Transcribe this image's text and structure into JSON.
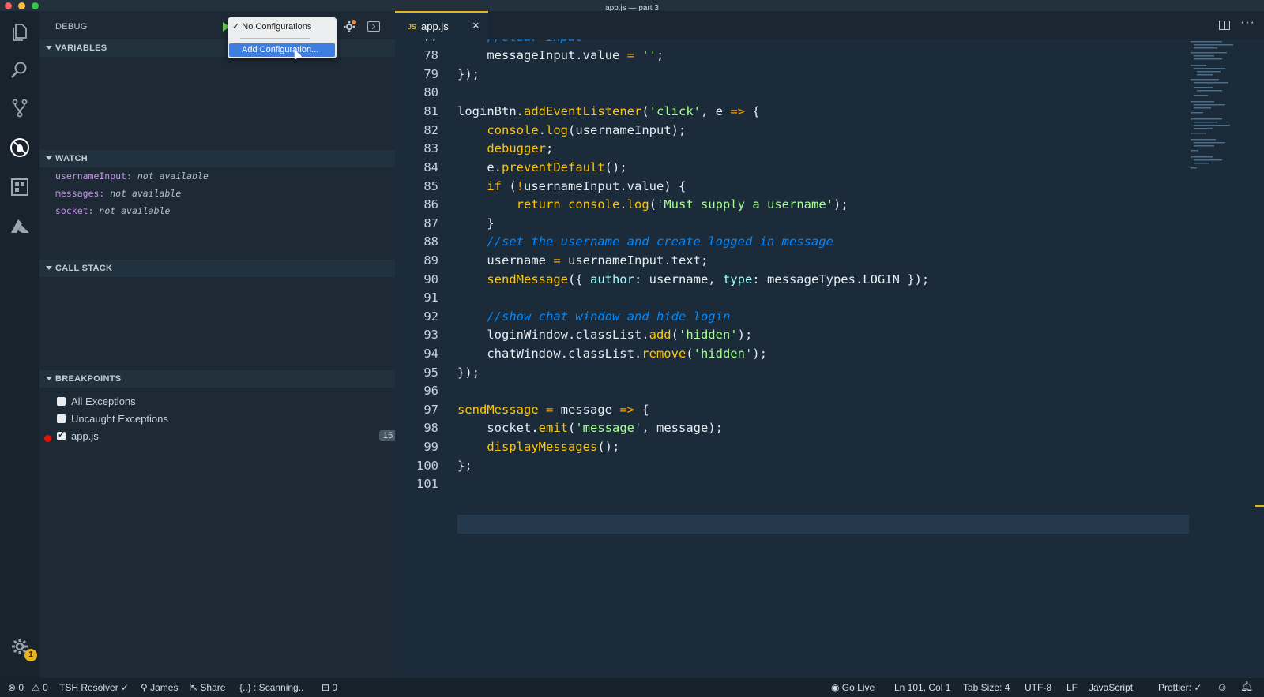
{
  "window": {
    "title": "app.js — part 3"
  },
  "colors": {
    "accent": "#e6b422",
    "breakpoint": "#e51400",
    "selection": "#3d7fe0"
  },
  "activity_bar": {
    "items": [
      "explorer-icon",
      "search-icon",
      "source-control-icon",
      "debug-icon",
      "extensions-icon",
      "azure-icon"
    ],
    "settings_badge": "1"
  },
  "debug": {
    "title": "DEBUG",
    "config_dropdown": {
      "selected": "✓ No Configurations",
      "option": "Add Configuration..."
    }
  },
  "sections": {
    "variables": "VARIABLES",
    "watch": "WATCH",
    "call_stack": "CALL STACK",
    "breakpoints": "BREAKPOINTS"
  },
  "watch": [
    {
      "name": "usernameInput:",
      "value": "not available"
    },
    {
      "name": "messages:",
      "value": "not available"
    },
    {
      "name": "socket:",
      "value": "not available"
    }
  ],
  "breakpoints": [
    {
      "label": "All Exceptions",
      "checked": false
    },
    {
      "label": "Uncaught Exceptions",
      "checked": false
    },
    {
      "label": "app.js",
      "checked": true,
      "count": "15"
    }
  ],
  "editor": {
    "tab": {
      "icon": "JS",
      "label": "app.js",
      "close": "×"
    }
  },
  "status": {
    "errors": "⊗ 0",
    "warnings": "⚠ 0",
    "tsh": "TSH Resolver ✓",
    "user": "⚲ James",
    "share": "⇱ Share",
    "scanning": "{..} : Scanning..",
    "refs": "⊟ 0",
    "golive": "◉ Go Live",
    "position": "Ln 101, Col 1",
    "tabsize": "Tab Size: 4",
    "encoding": "UTF-8",
    "eol": "LF",
    "language": "JavaScript",
    "prettier": "Prettier: ✓"
  }
}
